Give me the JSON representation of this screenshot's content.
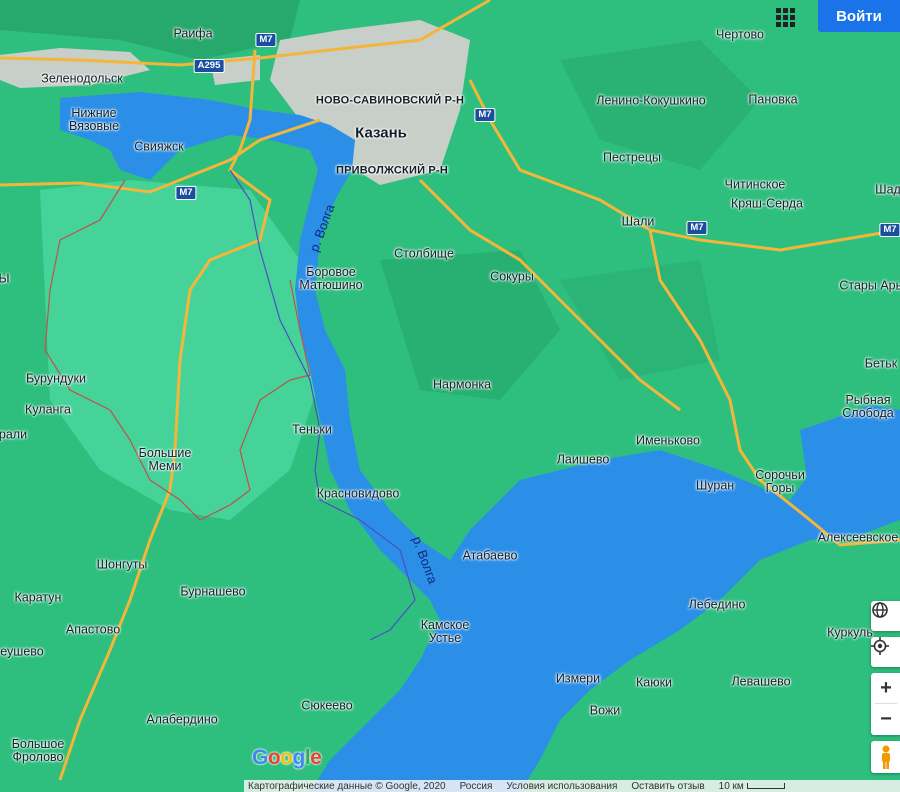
{
  "header": {
    "login_label": "Войти"
  },
  "places": {
    "raifa": "Раифа",
    "zelenodolsk": "Зеленодольск",
    "nizhnie_vyazovye": "Нижние Вязовые",
    "sviyazhsk": "Свияжск",
    "novo_savinovsky": "НОВО-САВИНОВСКИЙ Р-Н",
    "kazan": "Казань",
    "privolzhsky": "ПРИВОЛЖСКИЙ Р-Н",
    "chertovo": "Чертово",
    "lenino_kokushkino": "Ленино-Кокушкино",
    "panovka": "Пановка",
    "pestretsy": "Пестрецы",
    "chitinskoe": "Читинское",
    "kryash_serda": "Кряш-Серда",
    "shali": "Шали",
    "shad": "Шад",
    "stolbische": "Столбище",
    "borovoe_matyushino": "Боровое Матюшино",
    "sokury": "Сокуры",
    "stary_arysh": "Стары Арыш",
    "nizhnie_kalmy": "Ы",
    "burunduki": "Бурундуки",
    "kulanga": "Кулангa",
    "orali": "рали",
    "nармонка": "Нармонка",
    "betki": "Бетьк",
    "rybnaya_sloboda": "Рыбная Слобода",
    "tenki": "Теньки",
    "bolshie_memi": "Большие Меми",
    "imenkovo": "Именьково",
    "laishevo": "Лаишево",
    "shuran": "Шуран",
    "sorochi_gory": "Сорочьи Горы",
    "krasnovidovo": "Красновидово",
    "alekseevskoe": "Алексеевское",
    "shonguty": "Шонгуты",
    "atabaevo": "Атабаево",
    "buranshevo": "Бурнашево",
    "karatun": "Каратун",
    "lebedino": "Лебедино",
    "apastovo": "Апастово",
    "kamskoe_ustie": "Камское Устье",
    "kurkul": "Куркуль",
    "eushevo": "еушево",
    "izmeri": "Измери",
    "kayuki": "Каюки",
    "levashevo": "Левашево",
    "syukeevo": "Сюкеево",
    "vozhi": "Вожи",
    "alaberdino": "Алабердино",
    "bolshoe_frolovo": "Большое Фролово"
  },
  "rivers": {
    "volga_north": "р. Волга",
    "volga_south": "р. Волга"
  },
  "roads": {
    "m7_a": "M7",
    "a295": "A295",
    "m7_b": "M7",
    "m7_c": "M7",
    "m7_d": "M7",
    "m7_e": "M7"
  },
  "logo": {
    "letters": [
      "G",
      "o",
      "o",
      "g",
      "l",
      "e"
    ],
    "colors": [
      "#4285f4",
      "#ea4335",
      "#fbbc05",
      "#4285f4",
      "#34a853",
      "#ea4335"
    ]
  },
  "footer": {
    "map_data": "Картографические данные © Google, 2020",
    "country": "Россия",
    "terms": "Условия использования",
    "feedback": "Оставить отзыв",
    "scale": "10 км"
  },
  "colors": {
    "land": "#2ebf7e",
    "water": "#2b8fe8",
    "road": "#f3b63a",
    "urban": "#c8cfc9",
    "accent": "#1a73e8"
  },
  "icons": {
    "apps": "apps-grid-icon",
    "globe": "globe-icon",
    "location": "my-location-icon",
    "zoom_in": "plus-icon",
    "zoom_out": "minus-icon",
    "pegman": "pegman-icon"
  }
}
